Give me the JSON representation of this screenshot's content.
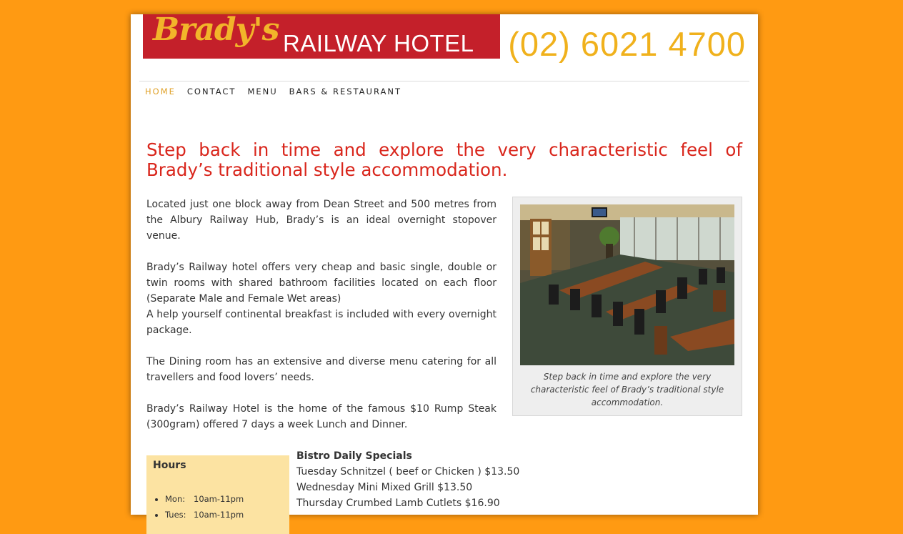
{
  "header": {
    "logo_script": "Brady's",
    "logo_text": "RAILWAY HOTEL",
    "phone": "(02) 6021 4700"
  },
  "nav": {
    "items": [
      {
        "label": "HOME"
      },
      {
        "label": "CONTACT"
      },
      {
        "label": "MENU"
      },
      {
        "label": "BARS & RESTAURANT"
      }
    ]
  },
  "main": {
    "headline": "Step back in time and explore the very characteristic feel of Brady’s traditional style accommodation.",
    "paragraphs": [
      "Located just one block away from Dean Street and 500 metres from the Albury Railway Hub, Brady’s is an ideal overnight stopover venue.",
      "Brady’s Railway hotel offers very cheap and basic single, double or twin rooms with shared bathroom facilities located on each floor (Separate Male and Female Wet areas)",
      "A help yourself continental breakfast is included with every overnight package.",
      "The Dining room has an extensive and diverse menu catering for all travellers and food lovers’ needs.",
      "Brady’s Railway Hotel is the home of the famous $10 Rump Steak (300gram) offered 7 days a week Lunch and Dinner."
    ],
    "photo_caption": "Step back in time and explore the very characteristic feel of Brady’s traditional style accommodation."
  },
  "hours": {
    "title": "Hours",
    "items": [
      {
        "day": "Mon:",
        "time": "10am-11pm"
      },
      {
        "day": "Tues:",
        "time": "10am-11pm"
      }
    ]
  },
  "specials": {
    "title": "Bistro Daily Specials",
    "items": [
      "Tuesday Schnitzel ( beef or Chicken ) $13.50",
      "Wednesday Mini Mixed Grill $13.50",
      "Thursday Crumbed Lamb Cutlets $16.90"
    ]
  },
  "colors": {
    "background": "#ff9a12",
    "logo_red": "#c4202a",
    "phone_gold": "#f0b11c",
    "headline_red": "#d9261c",
    "nav_active": "#e0a22a",
    "hours_bg": "#fce3a2"
  }
}
